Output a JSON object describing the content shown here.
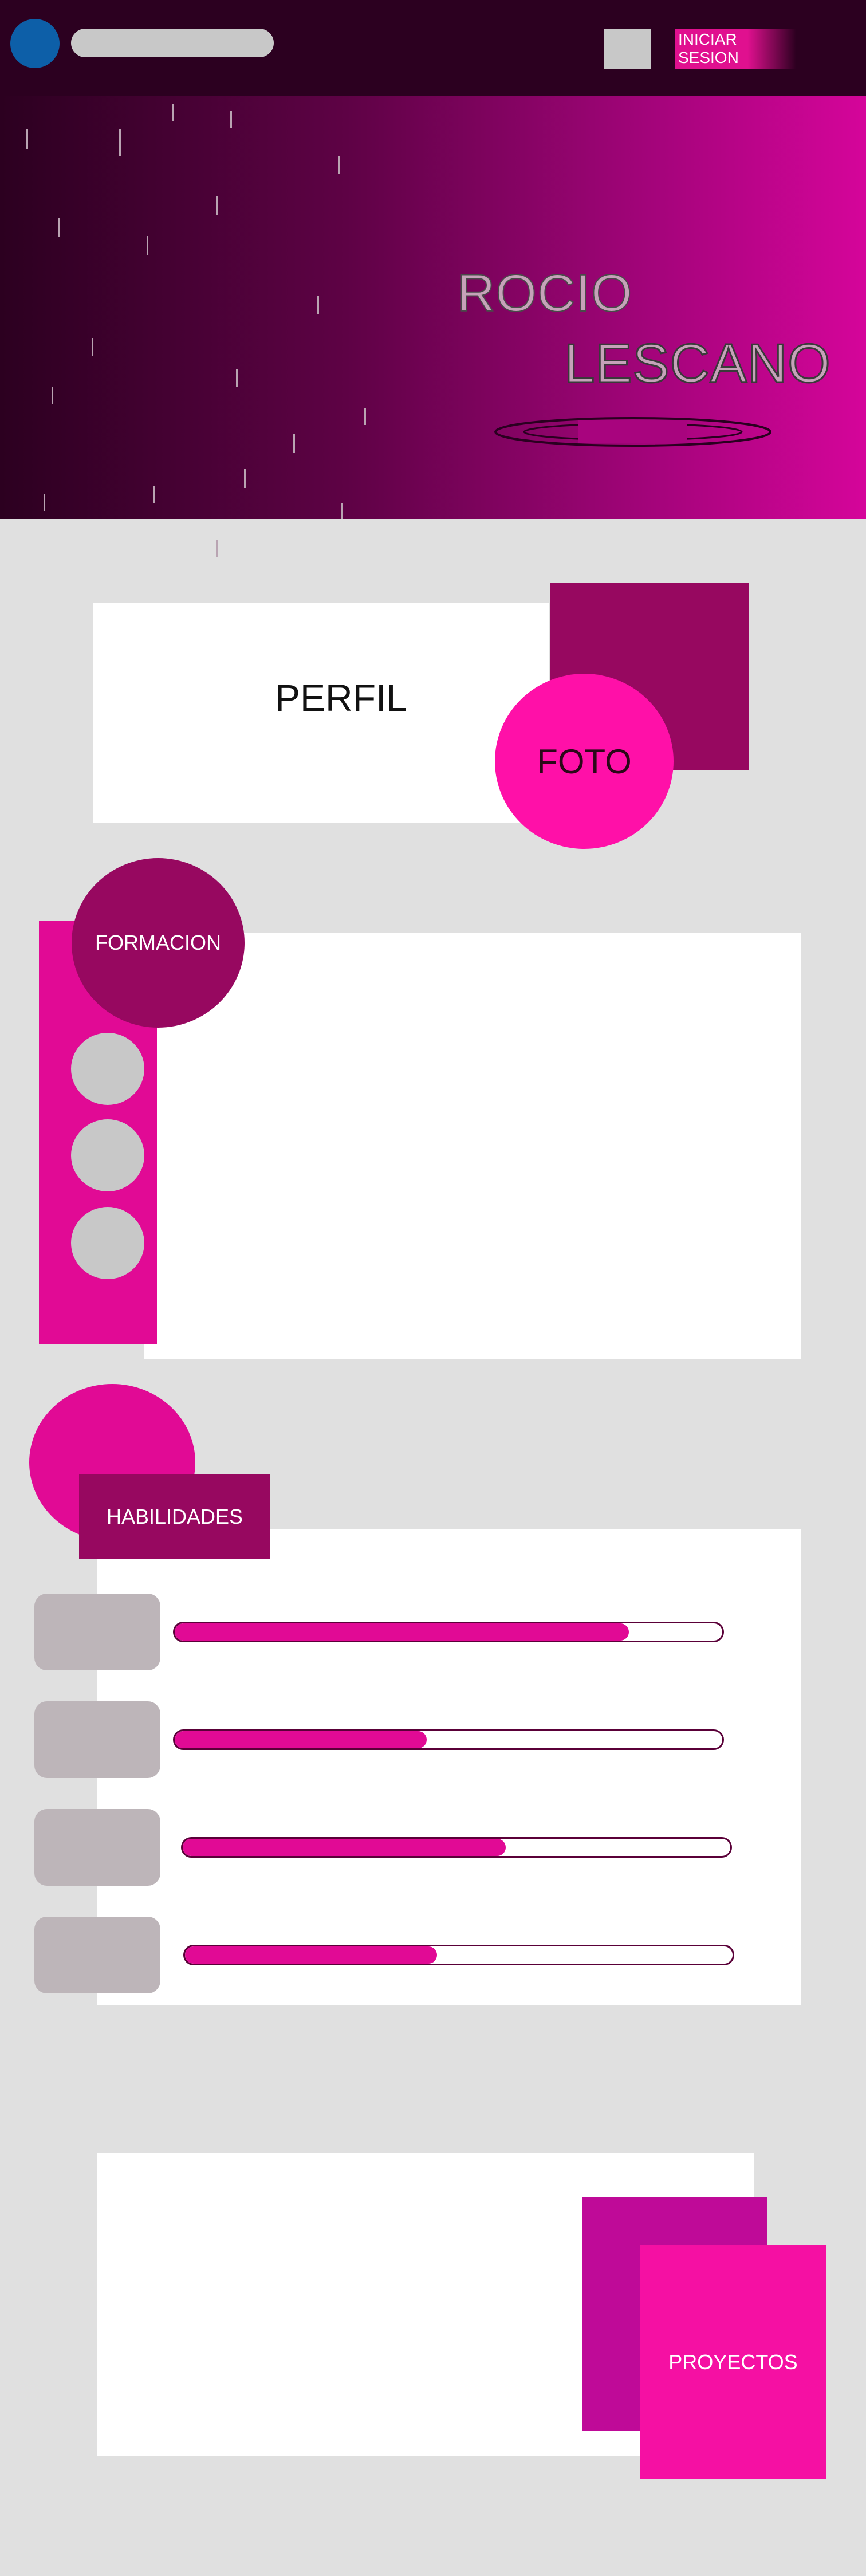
{
  "header": {
    "login_label": "INICIAR SESION"
  },
  "hero": {
    "first_name": "ROCIO",
    "last_name": "LESCANO"
  },
  "perfil": {
    "title": "PERFIL",
    "photo_label": "FOTO"
  },
  "formacion": {
    "title": "FORMACION"
  },
  "habilidades": {
    "title": "HABILIDADES",
    "skills": [
      {
        "level": 0.83
      },
      {
        "level": 0.46
      },
      {
        "level": 0.59
      },
      {
        "level": 0.46
      }
    ]
  },
  "proyectos": {
    "title": "PROYECTOS"
  },
  "colors": {
    "header_bg": "#2c0020",
    "accent_pink": "#e10a95",
    "accent_magenta": "#970860",
    "page_bg": "#e0e0e0"
  }
}
